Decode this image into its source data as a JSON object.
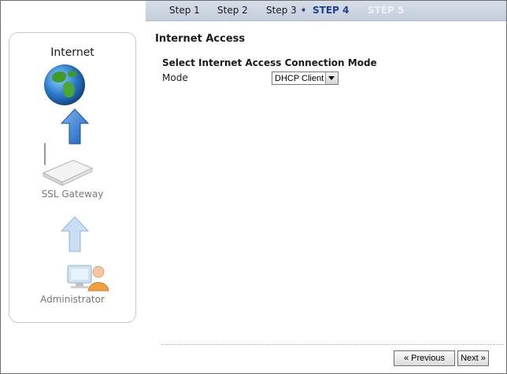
{
  "steps": {
    "step1": "Step 1",
    "step2": "Step 2",
    "step3": "Step 3",
    "step4": "STEP 4",
    "step5": "STEP 5"
  },
  "diagram": {
    "internet_label": "Internet",
    "gateway_label": "SSL Gateway",
    "admin_label": "Administrator"
  },
  "main": {
    "title": "Internet Access",
    "section_title": "Select Internet Access Connection Mode",
    "mode_label": "Mode",
    "mode_value": "DHCP Client"
  },
  "buttons": {
    "previous": "« Previous",
    "next": "Next »"
  },
  "colors": {
    "step_active": "#1f3e8c",
    "step_future": "#eef2f8",
    "stepbar_bg": "#c5cedd"
  },
  "icons": {
    "globe": "globe-icon",
    "router": "router-icon",
    "administrator": "administrator-icon",
    "up_arrow": "arrow-up-icon",
    "step_arrow": "step-arrow-icon"
  }
}
